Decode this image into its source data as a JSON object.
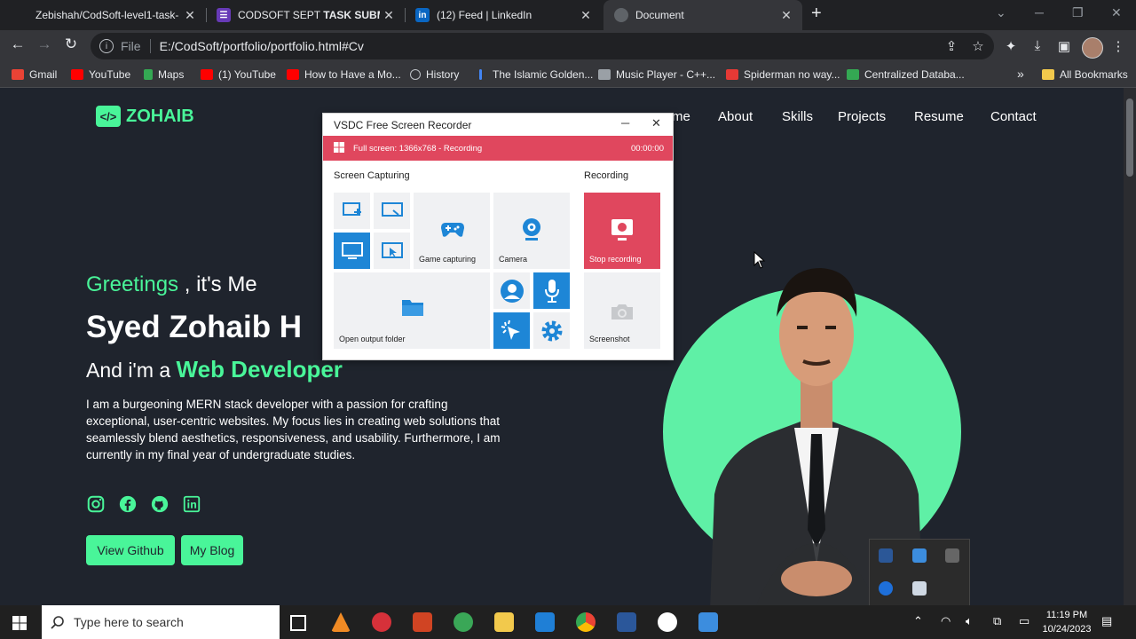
{
  "browser": {
    "tabs": [
      {
        "title": "Zebishah/CodSoft-level1-task-",
        "favicon_color": "#24292f"
      },
      {
        "title_prefix": "CODSOFT SEPT ",
        "title_bold": "TASK SUBMISSI",
        "favicon_color": "#673ab7"
      },
      {
        "title": "(12) Feed | LinkedIn",
        "favicon_color": "#0a66c2",
        "favicon_text": "in"
      },
      {
        "title": "Document",
        "favicon_color": "#5f6368",
        "active": true
      }
    ],
    "new_tab": "+",
    "address": {
      "scheme_label": "File",
      "url": "E:/CodSoft/portfolio/portfolio.html#Cv"
    },
    "bookmarks": [
      {
        "label": "Gmail",
        "color": "#ea4335"
      },
      {
        "label": "YouTube",
        "color": "#ff0000"
      },
      {
        "label": "Maps",
        "color": "#34a853"
      },
      {
        "label": "(1) YouTube",
        "color": "#ff0000"
      },
      {
        "label": "How to Have a Mo...",
        "color": "#ff0000"
      },
      {
        "label": "History",
        "color": "#bdc1c6"
      },
      {
        "label": "The Islamic Golden...",
        "color": "#4285f4"
      },
      {
        "label": "Music Player - C++...",
        "color": "#9aa0a6"
      },
      {
        "label": "Spiderman no way...",
        "color": "#e53935"
      },
      {
        "label": "Centralized Databa...",
        "color": "#34a853"
      }
    ],
    "bookmarks_more": "»",
    "all_bookmarks": "All Bookmarks"
  },
  "site": {
    "logo": "ZOHAIB",
    "nav": [
      "me",
      "About",
      "Skills",
      "Projects",
      "Resume",
      "Contact"
    ],
    "greeting_highlight": "Greetings",
    "greeting_rest": " , it's Me",
    "name": "Syed Zohaib H",
    "role_prefix": "And i'm a ",
    "role_highlight": "Web Developer",
    "description": "I am a burgeoning MERN stack developer with a passion for crafting exceptional, user-centric websites. My focus lies in creating web solutions that seamlessly blend aesthetics, responsiveness, and usability. Furthermore, I am currently in my final year of undergraduate studies.",
    "social": [
      "instagram-icon",
      "facebook-icon",
      "github-icon",
      "linkedin-icon"
    ],
    "buttons": {
      "github": "View Github",
      "blog": "My Blog"
    },
    "accent": "#49f599"
  },
  "recorder": {
    "title": "VSDC Free Screen Recorder",
    "status": "Full screen: 1366x768 - Recording",
    "time": "00:00:00",
    "section_capture": "Screen Capturing",
    "section_recording": "Recording",
    "game_capturing": "Game capturing",
    "camera": "Camera",
    "stop_recording": "Stop recording",
    "open_output": "Open output folder",
    "screenshot": "Screenshot",
    "accent": "#e0475e"
  },
  "taskbar": {
    "search_placeholder": "Type here to search",
    "time": "11:19 PM",
    "date": "10/24/2023"
  }
}
